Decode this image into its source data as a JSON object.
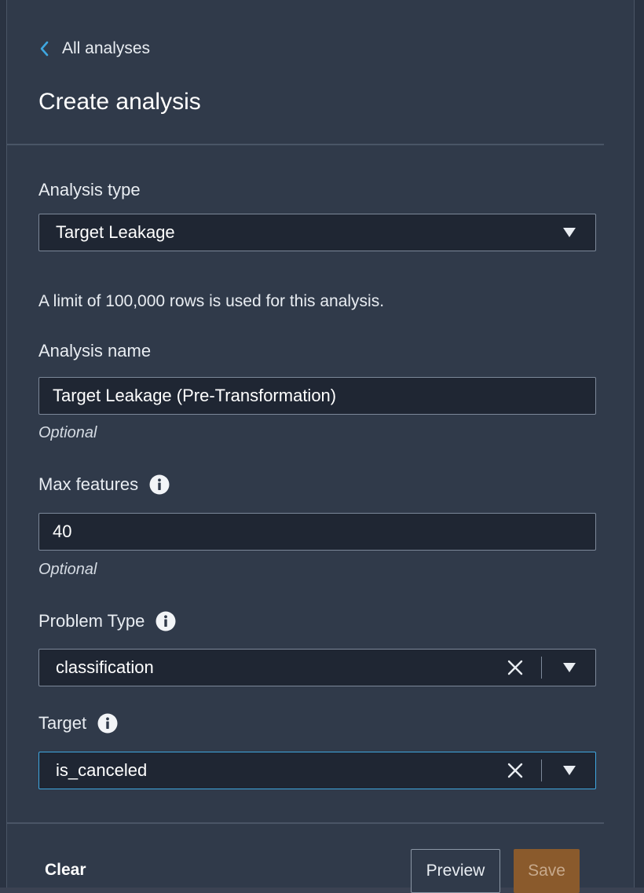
{
  "header": {
    "back_label": "All analyses",
    "title": "Create analysis"
  },
  "analysis_type": {
    "label": "Analysis type",
    "selected": "Target Leakage"
  },
  "note": "A limit of 100,000 rows is used for this analysis.",
  "analysis_name": {
    "label": "Analysis name",
    "value": "Target Leakage (Pre-Transformation)",
    "helper": "Optional"
  },
  "max_features": {
    "label": "Max features",
    "value": "40",
    "helper": "Optional"
  },
  "problem_type": {
    "label": "Problem Type",
    "selected": "classification"
  },
  "target": {
    "label": "Target",
    "selected": "is_canceled"
  },
  "footer": {
    "clear_label": "Clear",
    "preview_label": "Preview",
    "save_label": "Save"
  },
  "colors": {
    "panel_bg": "#303a4a",
    "input_bg": "#1f2633",
    "focus_border": "#3fa7e0",
    "accent_link": "#3fa7e0",
    "save_bg": "#8a5a2c"
  },
  "icons": {
    "back": "chevron-left-icon",
    "info": "info-icon",
    "clear": "close-icon",
    "dropdown": "caret-down-icon"
  }
}
